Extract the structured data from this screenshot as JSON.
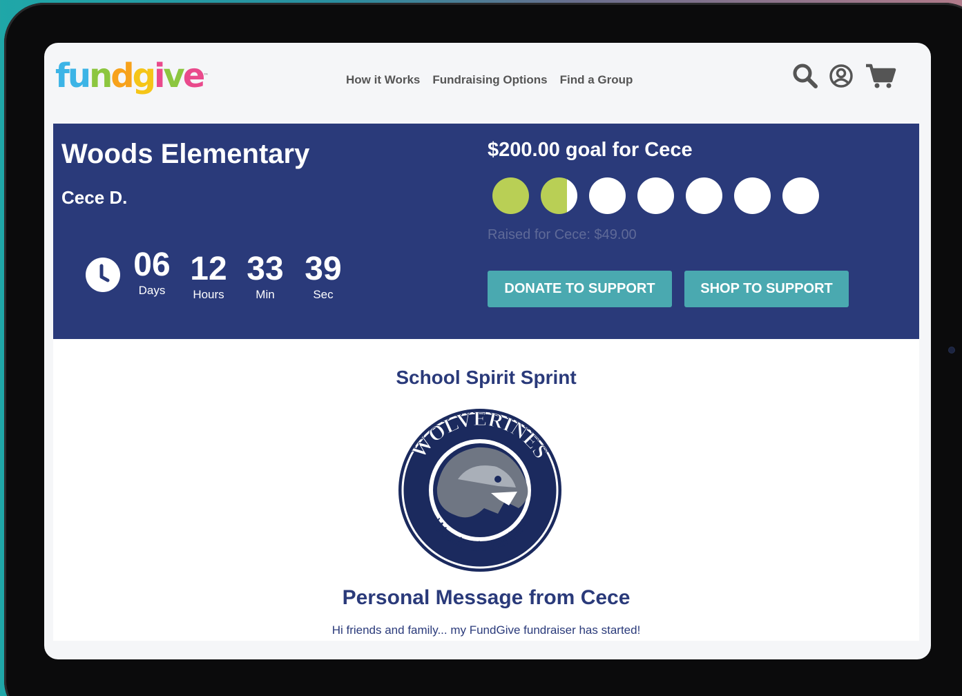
{
  "brand": {
    "logo_letters": [
      "f",
      "u",
      "n",
      "d",
      "g",
      "i",
      "v",
      "e"
    ],
    "logo_colors": [
      "#3cb4e6",
      "#3cb4e6",
      "#8cc63f",
      "#f7a21b",
      "#f5c518",
      "#e94a8c",
      "#8cc63f",
      "#e94a8c"
    ],
    "trademark": "™"
  },
  "nav": {
    "items": [
      "How it Works",
      "Fundraising Options",
      "Find a Group"
    ]
  },
  "header_icons": [
    "search-icon",
    "account-icon",
    "cart-icon"
  ],
  "hero": {
    "school": "Woods Elementary",
    "student": "Cece D.",
    "countdown": [
      {
        "value": "06",
        "label": "Days"
      },
      {
        "value": "12",
        "label": "Hours"
      },
      {
        "value": "33",
        "label": "Min"
      },
      {
        "value": "39",
        "label": "Sec"
      }
    ],
    "goal": "$200.00 goal for Cece",
    "raised": "Raised for Cece: $49.00",
    "progress_fraction": 0.245,
    "progress_dots": 7,
    "progress_color": "#b9cf55",
    "donate_button": "DONATE TO SUPPORT",
    "shop_button": "SHOP TO SUPPORT"
  },
  "content": {
    "campaign_title": "School Spirit Sprint",
    "mascot_top_text": "WOLVERINES",
    "mascot_bottom_text": "Woods Elementary",
    "message_title": "Personal Message from Cece",
    "message_body": "Hi friends and family... my FundGive fundraiser has started!"
  },
  "colors": {
    "hero_bg": "#2a3a7a",
    "button_bg": "#4aa9b0",
    "title_color": "#2a3a7a"
  }
}
